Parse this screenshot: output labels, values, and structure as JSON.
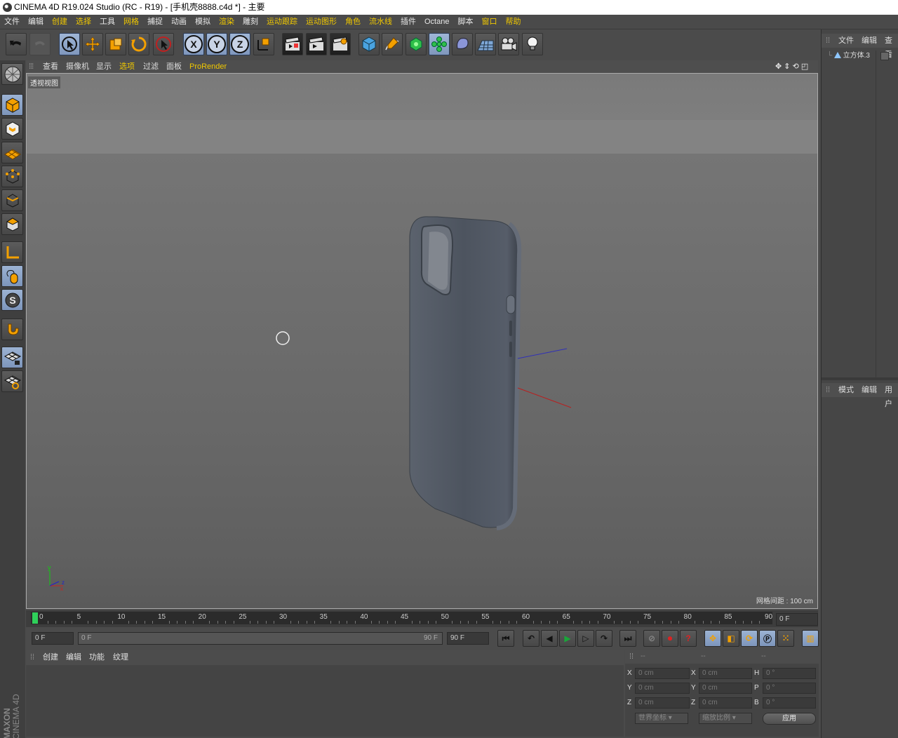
{
  "titlebar": {
    "title": "CINEMA 4D R19.024 Studio (RC - R19) - [手机壳8888.c4d *] - 主要"
  },
  "menubar": {
    "items": [
      {
        "label": "文件",
        "highlight": false
      },
      {
        "label": "编辑",
        "highlight": false
      },
      {
        "label": "创建",
        "highlight": true
      },
      {
        "label": "选择",
        "highlight": true
      },
      {
        "label": "工具",
        "highlight": false
      },
      {
        "label": "网格",
        "highlight": true
      },
      {
        "label": "捕捉",
        "highlight": false
      },
      {
        "label": "动画",
        "highlight": false
      },
      {
        "label": "模拟",
        "highlight": false
      },
      {
        "label": "渲染",
        "highlight": true
      },
      {
        "label": "雕刻",
        "highlight": false
      },
      {
        "label": "运动跟踪",
        "highlight": true
      },
      {
        "label": "运动图形",
        "highlight": true
      },
      {
        "label": "角色",
        "highlight": true
      },
      {
        "label": "流水线",
        "highlight": true
      },
      {
        "label": "插件",
        "highlight": false
      },
      {
        "label": "Octane",
        "highlight": false
      },
      {
        "label": "脚本",
        "highlight": false
      },
      {
        "label": "窗口",
        "highlight": true
      },
      {
        "label": "帮助",
        "highlight": true
      }
    ]
  },
  "toolbar": {
    "x_label": "X",
    "y_label": "Y",
    "z_label": "Z"
  },
  "viewport": {
    "menu": [
      {
        "label": "查看",
        "highlight": false
      },
      {
        "label": "摄像机",
        "highlight": false
      },
      {
        "label": "显示",
        "highlight": false
      },
      {
        "label": "选项",
        "highlight": true
      },
      {
        "label": "过滤",
        "highlight": false
      },
      {
        "label": "面板",
        "highlight": false
      },
      {
        "label": "ProRender",
        "highlight": true
      }
    ],
    "label": "透视视图",
    "grid_info": "网格间距 : 100 cm"
  },
  "object_manager": {
    "menu": [
      "文件",
      "编辑",
      "查看"
    ],
    "object_name": "立方体.3"
  },
  "attribute_manager": {
    "menu": [
      "模式",
      "编辑",
      "用户"
    ]
  },
  "timeline": {
    "ticks": [
      "0",
      "5",
      "10",
      "15",
      "20",
      "25",
      "30",
      "35",
      "40",
      "45",
      "50",
      "55",
      "60",
      "65",
      "70",
      "75",
      "80",
      "85",
      "90"
    ],
    "current_frame_field": "0 F"
  },
  "playbar": {
    "start_field": "0 F",
    "range_start": "0 F",
    "range_end": "90 F",
    "end_field": "90 F"
  },
  "material_manager": {
    "menu": [
      "创建",
      "编辑",
      "功能",
      "纹理"
    ]
  },
  "coordinates": {
    "header": [
      "--",
      "--",
      "--"
    ],
    "rows": [
      {
        "pos_label": "X",
        "pos": "0 cm",
        "size_label": "X",
        "size": "0 cm",
        "rot_label": "H",
        "rot": "0 °"
      },
      {
        "pos_label": "Y",
        "pos": "0 cm",
        "size_label": "Y",
        "size": "0 cm",
        "rot_label": "P",
        "rot": "0 °"
      },
      {
        "pos_label": "Z",
        "pos": "0 cm",
        "size_label": "Z",
        "size": "0 cm",
        "rot_label": "B",
        "rot": "0 °"
      }
    ],
    "world_coords": "世界坐标",
    "scale": "缩放比例",
    "apply": "应用"
  },
  "branding": {
    "maxon": "MAXON",
    "product": "CINEMA 4D"
  },
  "colors": {
    "accent_yellow": "#f0c800",
    "active_blue": "#8aa3c8",
    "phone": "#4e5560"
  }
}
